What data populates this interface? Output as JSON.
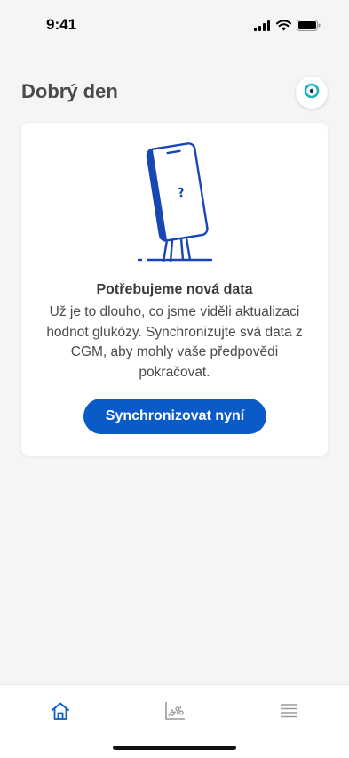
{
  "status_bar": {
    "time": "9:41",
    "icons": [
      "cellular-signal-icon",
      "wifi-icon",
      "battery-icon"
    ]
  },
  "header": {
    "greeting": "Dobrý den",
    "profile_icon": "ring-icon"
  },
  "card": {
    "illustration_icon": "phone-question-icon",
    "title": "Potřebujeme nová data",
    "body": "Už je to dlouho, co jsme viděli aktualizaci hodnot glukózy. Synchronizujte svá data z CGM, aby mohly vaše předpovědi pokračovat.",
    "button_label": "Synchronizovat nyní"
  },
  "tab_bar": {
    "tabs": [
      {
        "icon": "home-icon",
        "active": true
      },
      {
        "icon": "chart-icon",
        "active": false
      },
      {
        "icon": "menu-icon",
        "active": false
      }
    ]
  },
  "colors": {
    "accent": "#0a5ac8",
    "profile_ring": "#1ab3bf",
    "background": "#f5f5f5",
    "inactive_icon": "#9a9a9a"
  }
}
